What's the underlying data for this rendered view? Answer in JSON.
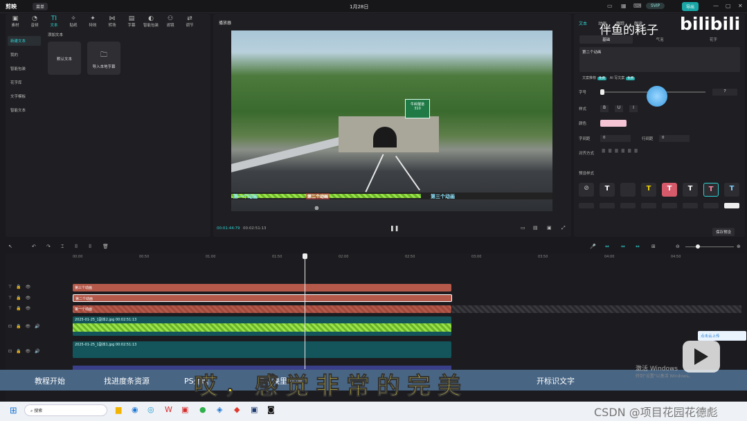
{
  "titlebar": {
    "app_logo": "剪映",
    "menu": "菜单",
    "doc_title": "1月28日",
    "svip": "SVIP",
    "export": "导出",
    "win_min": "—",
    "win_max": "▢",
    "win_close": "✕"
  },
  "left_panel": {
    "tools": [
      {
        "icon": "▣",
        "label": "素材"
      },
      {
        "icon": "◔",
        "label": "音频"
      },
      {
        "icon": "TI",
        "label": "文本"
      },
      {
        "icon": "✧",
        "label": "贴纸"
      },
      {
        "icon": "✦",
        "label": "特效"
      },
      {
        "icon": "⋈",
        "label": "转场"
      },
      {
        "icon": "▤",
        "label": "字幕"
      },
      {
        "icon": "◐",
        "label": "智能包装"
      },
      {
        "icon": "⚇",
        "label": "滤镜"
      },
      {
        "icon": "⇄",
        "label": "调节"
      }
    ],
    "sub_items": [
      "新建文本",
      "我的",
      "智能包装",
      "花字库",
      "文字模板",
      "智能文本"
    ],
    "add_text_label": "添加文本",
    "card_default": "默认文本",
    "card_import": "导入本地字幕"
  },
  "player": {
    "title": "播放器",
    "sign_text": "牛岭隧道",
    "sign_num": "310",
    "text_track1": "第一个动画",
    "text_track2": "第三个动画",
    "text_track3": "第二个动画",
    "time_current": "00:01:44:79",
    "time_total": "00:02:51:13"
  },
  "right_panel": {
    "tabs": [
      "文本",
      "动画",
      "跟踪",
      "朗读"
    ],
    "sub_tabs": [
      "基础",
      "气泡",
      "花字"
    ],
    "text_value": "第二个动画",
    "ai_row": "文案推荐",
    "ai_write": "AI 写文案",
    "badge": "免费",
    "size_label": "字号",
    "size_value": "7",
    "style_label": "样式",
    "color_label": "颜色",
    "char_spacing_label": "字间距",
    "char_spacing_value": "0",
    "line_spacing_label": "行间距",
    "line_spacing_value": "0",
    "align_label": "对齐方式",
    "preset_label": "预设样式",
    "save_preset": "保存预设",
    "presets": [
      {
        "fill": "#ffffff",
        "bg": "#2c2c31"
      },
      {
        "fill": "#2c2c31",
        "bg": "#2c2c31"
      },
      {
        "fill": "#f2d500",
        "bg": "#2c2c31"
      },
      {
        "fill": "#ffffff",
        "bg": "#d65a6a"
      },
      {
        "fill": "#ffffff",
        "bg": "#2c2c31"
      },
      {
        "fill": "#f28aa0",
        "bg": "#2c2c31"
      },
      {
        "fill": "#7fd0ff",
        "bg": "#2c2c31"
      }
    ]
  },
  "timeline": {
    "ruler": [
      "00:00",
      "00:50",
      "01:00",
      "01:50",
      "02:00",
      "02:50",
      "03:00",
      "03:50",
      "04:00",
      "04:50"
    ],
    "text_tracks": [
      "第三个动画",
      "第二个动画",
      "第一个动画"
    ],
    "video1": "2025-01-25_1副本2.jpg  00:02:51:13",
    "video2": "2025-01-25_1副本1.jpg  00:02:51:13",
    "cloud_upload": "点击云上传"
  },
  "overlay": {
    "subtitle_items": [
      "教程开始",
      "找进度条资源",
      "PS处理",
      "在剪映里处理",
      "开标识文字"
    ],
    "caption": "哎，感觉非常的完美",
    "watermark_channel": "伴鱼的耗子",
    "watermark_bili": "bilibili",
    "activate": "激活 Windows",
    "activate_sub": "转到\"设置\"以激活 Windows。",
    "csdn": "CSDN @项目花园花德彪"
  },
  "taskbar": {
    "search": "搜索"
  }
}
